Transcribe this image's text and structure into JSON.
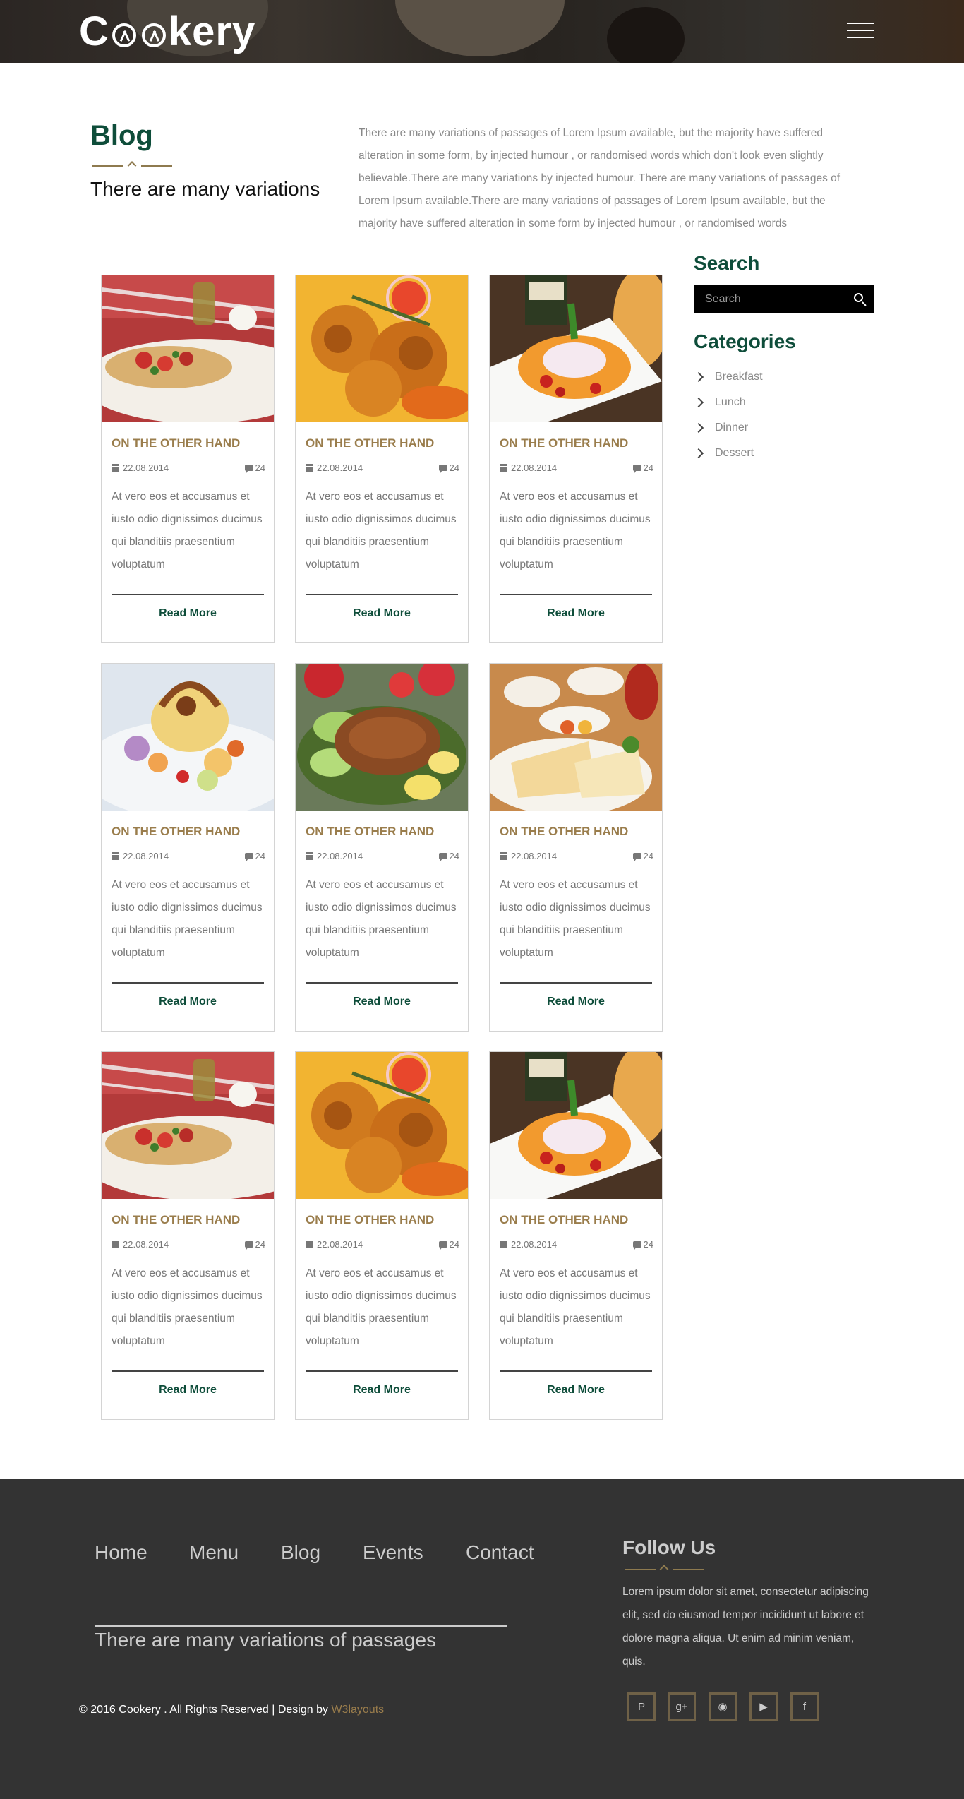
{
  "header": {
    "logo_prefix": "C",
    "logo_suffix": "kery"
  },
  "intro": {
    "title": "Blog",
    "subtitle": "There are many variations",
    "paragraph": "There are many variations of passages of Lorem Ipsum available, but the majority have suffered alteration in some form, by injected humour , or randomised words which don't look even slightly believable.There are many variations by injected humour. There are many variations of passages of Lorem Ipsum available.There are many variations of passages of Lorem Ipsum available, but the majority have suffered alteration in some form by injected humour , or randomised words"
  },
  "posts": [
    {
      "title": "ON THE OTHER HAND",
      "date": "22.08.2014",
      "comments": "24",
      "text": "At vero eos et accusamus et iusto odio dignissimos ducimus qui blanditiis praesentium voluptatum",
      "more": "Read More",
      "image": "bruschetta"
    },
    {
      "title": "ON THE OTHER HAND",
      "date": "22.08.2014",
      "comments": "24",
      "text": "At vero eos et accusamus et iusto odio dignissimos ducimus qui blanditiis praesentium voluptatum",
      "more": "Read More",
      "image": "meatballs"
    },
    {
      "title": "ON THE OTHER HAND",
      "date": "22.08.2014",
      "comments": "24",
      "text": "At vero eos et accusamus et iusto odio dignissimos ducimus qui blanditiis praesentium voluptatum",
      "more": "Read More",
      "image": "pasta"
    },
    {
      "title": "ON THE OTHER HAND",
      "date": "22.08.2014",
      "comments": "24",
      "text": "At vero eos et accusamus et iusto odio dignissimos ducimus qui blanditiis praesentium voluptatum",
      "more": "Read More",
      "image": "dessert"
    },
    {
      "title": "ON THE OTHER HAND",
      "date": "22.08.2014",
      "comments": "24",
      "text": "At vero eos et accusamus et iusto odio dignissimos ducimus qui blanditiis praesentium voluptatum",
      "more": "Read More",
      "image": "grilled-meat"
    },
    {
      "title": "ON THE OTHER HAND",
      "date": "22.08.2014",
      "comments": "24",
      "text": "At vero eos et accusamus et iusto odio dignissimos ducimus qui blanditiis praesentium voluptatum",
      "more": "Read More",
      "image": "breakfast-spread"
    },
    {
      "title": "ON THE OTHER HAND",
      "date": "22.08.2014",
      "comments": "24",
      "text": "At vero eos et accusamus et iusto odio dignissimos ducimus qui blanditiis praesentium voluptatum",
      "more": "Read More",
      "image": "bruschetta"
    },
    {
      "title": "ON THE OTHER HAND",
      "date": "22.08.2014",
      "comments": "24",
      "text": "At vero eos et accusamus et iusto odio dignissimos ducimus qui blanditiis praesentium voluptatum",
      "more": "Read More",
      "image": "meatballs"
    },
    {
      "title": "ON THE OTHER HAND",
      "date": "22.08.2014",
      "comments": "24",
      "text": "At vero eos et accusamus et iusto odio dignissimos ducimus qui blanditiis praesentium voluptatum",
      "more": "Read More",
      "image": "pasta"
    }
  ],
  "sidebar": {
    "search_title": "Search",
    "search_placeholder": "Search",
    "categories_title": "Categories",
    "categories": [
      "Breakfast",
      "Lunch",
      "Dinner",
      "Dessert"
    ]
  },
  "footer": {
    "nav": [
      "Home",
      "Menu",
      "Blog",
      "Events",
      "Contact"
    ],
    "tagline": "There are many variations of passages",
    "follow_title": "Follow Us",
    "follow_text": "Lorem ipsum dolor sit amet, consectetur adipiscing elit, sed do eiusmod tempor incididunt ut labore et dolore magna aliqua. Ut enim ad minim veniam, quis.",
    "copyright": "© 2016 Cookery . All Rights Reserved | Design by ",
    "designer": "W3layouts",
    "social": [
      "pinterest-icon",
      "google-plus-icon",
      "instagram-icon",
      "youtube-icon",
      "facebook-icon"
    ]
  },
  "colors": {
    "brand_green": "#0e4d3a",
    "accent_gold": "#9a7d4c",
    "footer_bg": "#333333"
  }
}
